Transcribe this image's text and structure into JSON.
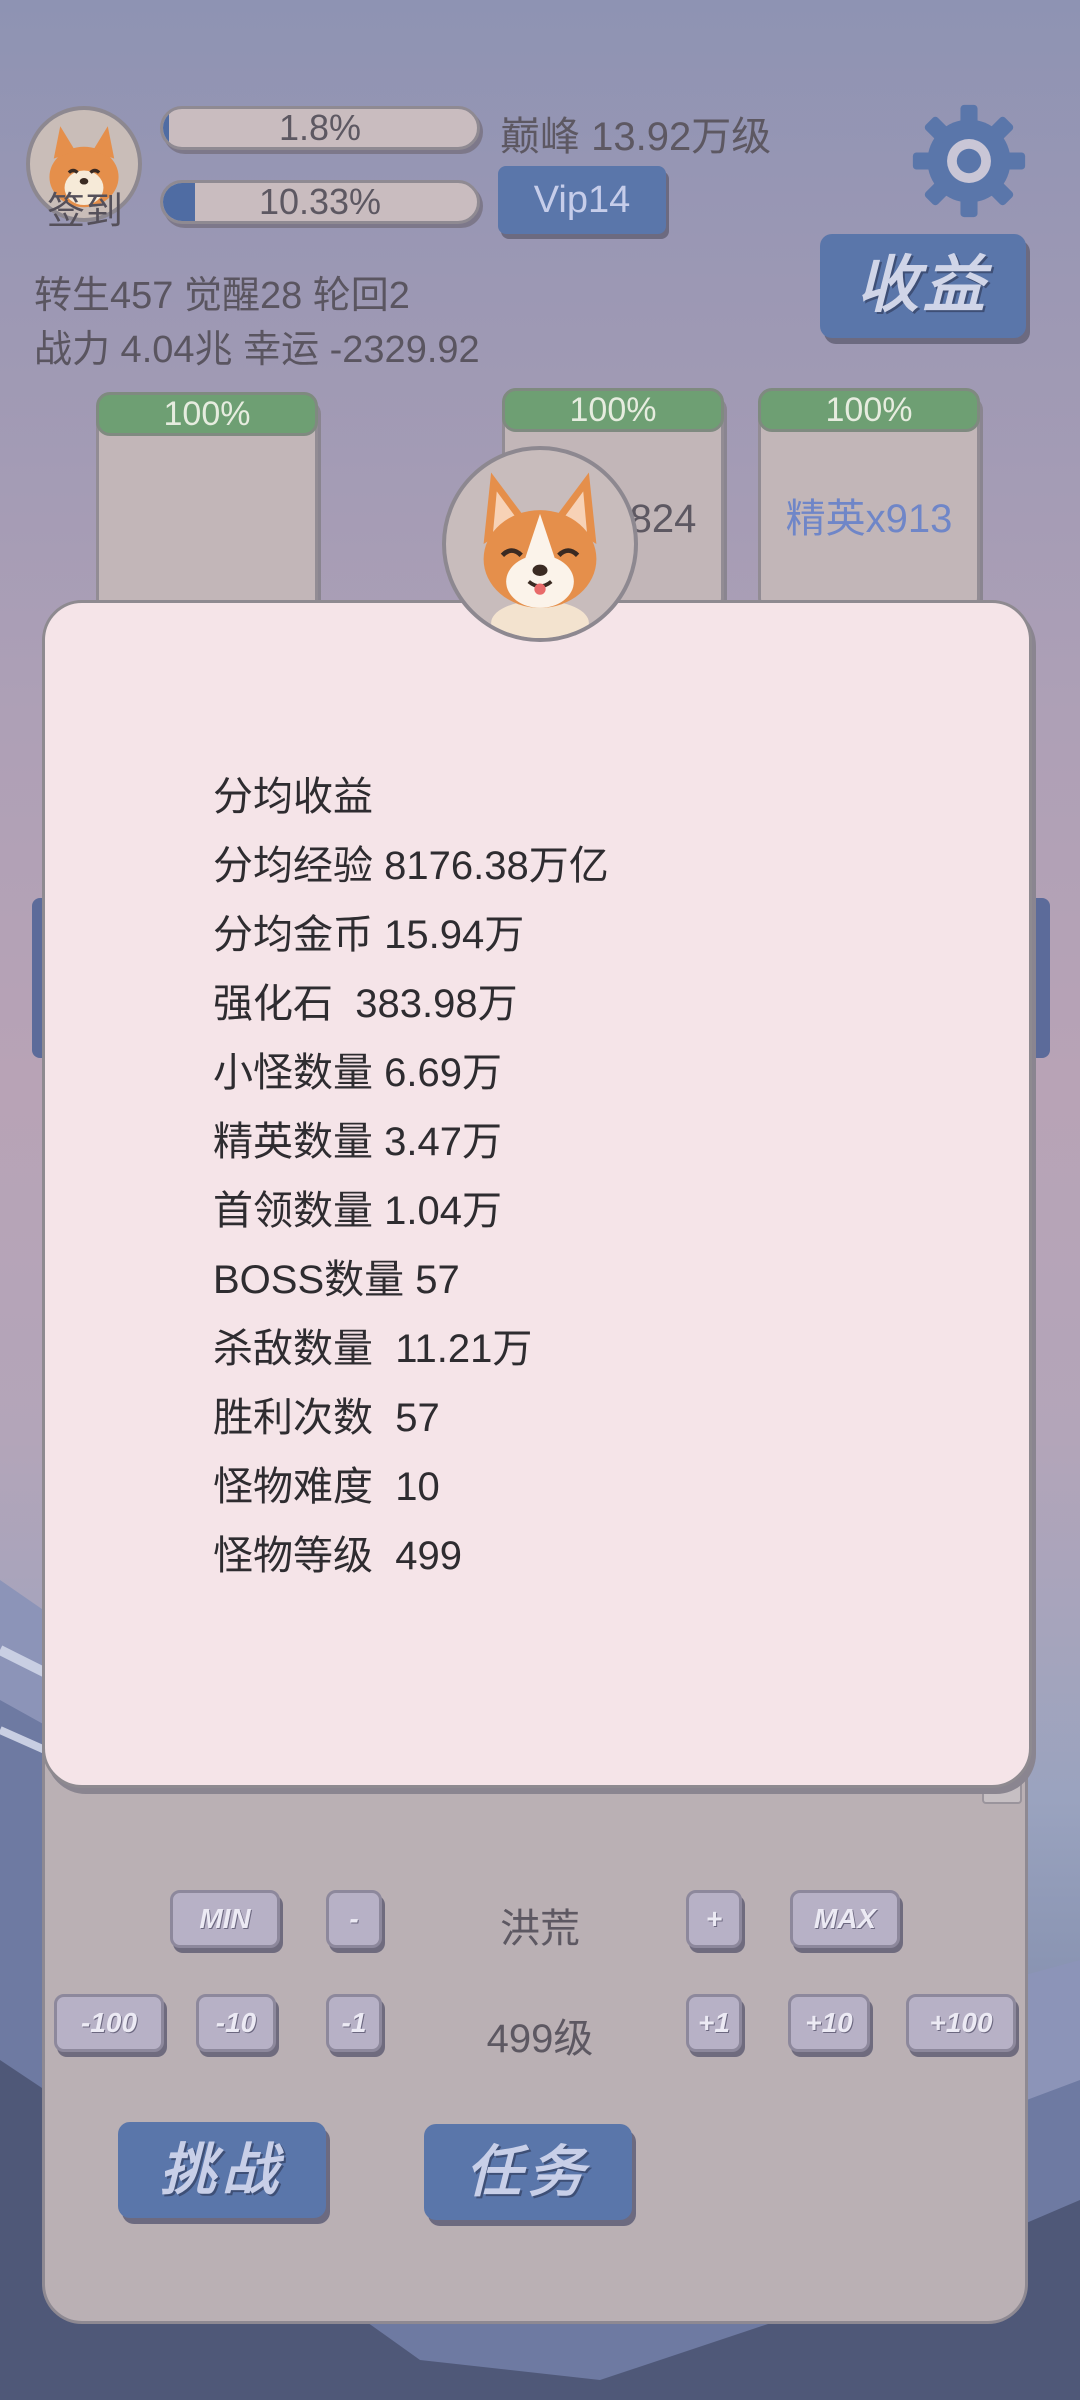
{
  "header": {
    "avatar_label": "签到",
    "exp_bar": {
      "text": "1.8%",
      "fill_percent": 1.8
    },
    "second_bar": {
      "text": "10.33%",
      "fill_percent": 10.33
    },
    "peak_text": "巅峰 13.92万级",
    "vip_label": "Vip14",
    "income_label": "收益",
    "rebirth_line": "转生457 觉醒28 轮回2",
    "power_line": "战力 4.04兆  幸运 -2329.92"
  },
  "cards": [
    {
      "percent": "100%",
      "label": ""
    },
    {
      "percent": "100%",
      "label": "小怪x824"
    },
    {
      "percent": "100%",
      "label": "精英x913"
    }
  ],
  "modal": {
    "title": "分均收益",
    "lines": [
      "分均经验 8176.38万亿",
      "分均金币 15.94万",
      "强化石  383.98万",
      "小怪数量 6.69万",
      "精英数量 3.47万",
      "首领数量 1.04万",
      "BOSS数量 57",
      "杀敌数量  11.21万",
      "胜利次数  57",
      "怪物难度  10",
      "怪物等级  499"
    ]
  },
  "controls": {
    "row1": {
      "min": "MIN",
      "minus": "-",
      "center": "洪荒",
      "plus": "+",
      "max": "MAX"
    },
    "row2": {
      "m100": "-100",
      "m10": "-10",
      "m1": "-1",
      "center": "499级",
      "p1": "+1",
      "p10": "+10",
      "p100": "+100"
    },
    "challenge": "挑战",
    "task": "任务"
  },
  "colors": {
    "accent_blue": "#5a76aa",
    "card_green": "#6e9f73",
    "elite_text": "#6f86c8",
    "modal_bg": "#f5e4e8"
  }
}
